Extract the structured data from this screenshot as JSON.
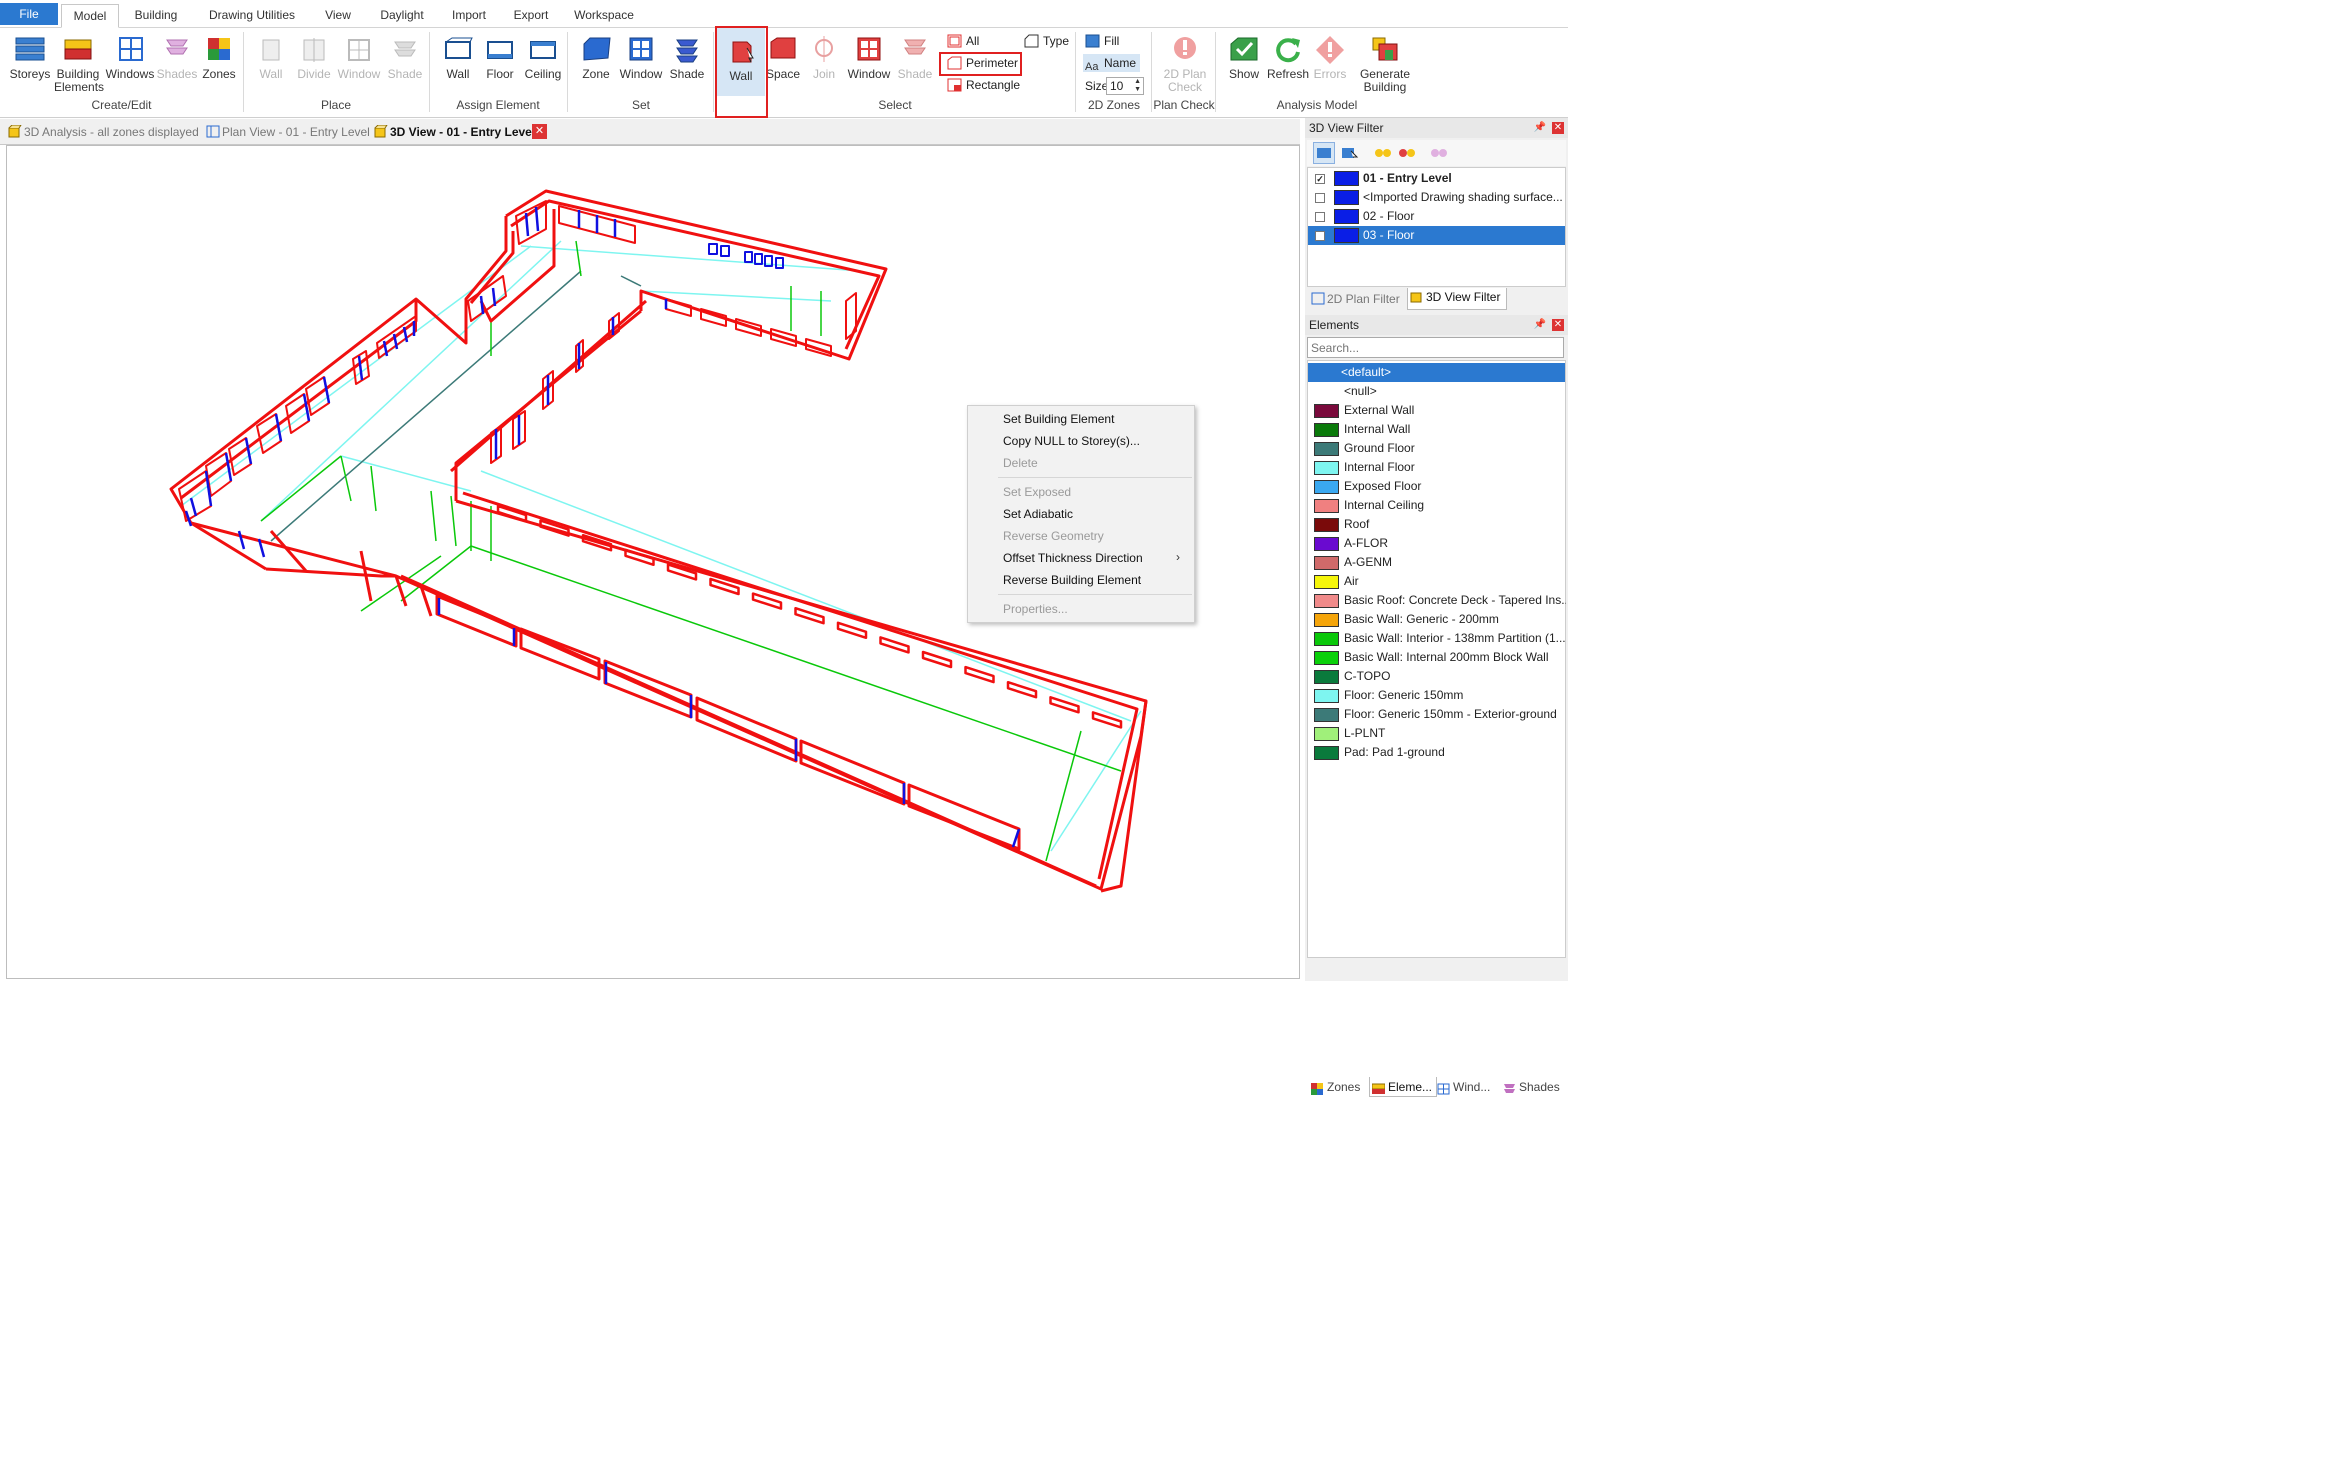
{
  "menu_tabs": [
    "File",
    "Model",
    "Building",
    "Drawing Utilities",
    "View",
    "Daylight",
    "Import",
    "Export",
    "Workspace"
  ],
  "ribbon": {
    "create_edit": {
      "label": "Create/Edit",
      "storeys": "Storeys",
      "building_elements_1": "Building",
      "building_elements_2": "Elements",
      "windows": "Windows",
      "shades": "Shades",
      "zones": "Zones"
    },
    "place": {
      "label": "Place",
      "wall": "Wall",
      "divide": "Divide",
      "window": "Window",
      "shade": "Shade"
    },
    "assign": {
      "label": "Assign Element",
      "wall": "Wall",
      "floor": "Floor",
      "ceiling": "Ceiling"
    },
    "set": {
      "label": "Set",
      "zone": "Zone",
      "window": "Window",
      "shade": "Shade"
    },
    "select": {
      "label": "Select",
      "wall": "Wall",
      "space": "Space",
      "join": "Join",
      "window": "Window",
      "shade": "Shade",
      "all": "All",
      "perimeter": "Perimeter",
      "rectangle": "Rectangle",
      "type": "Type"
    },
    "zones2d": {
      "label": "2D Zones",
      "fill": "Fill",
      "name": "Name",
      "size_label": "Size",
      "size_value": "10"
    },
    "plan_check": {
      "label": "Plan Check",
      "btn_1": "2D Plan",
      "btn_2": "Check"
    },
    "analysis": {
      "label": "Analysis Model",
      "show": "Show",
      "refresh": "Refresh",
      "errors": "Errors",
      "generate_1": "Generate",
      "generate_2": "Building"
    }
  },
  "doc_tabs": [
    "3D Analysis - all zones displayed",
    "Plan View - 01 - Entry Level",
    "3D View - 01 - Entry Level"
  ],
  "view_filter": {
    "title": "3D View Filter",
    "items": [
      {
        "label": "01 - Entry Level",
        "checked": true
      },
      {
        "label": "<Imported Drawing shading surface...",
        "checked": false
      },
      {
        "label": "02 - Floor",
        "checked": false
      },
      {
        "label": "03 - Floor",
        "checked": false
      }
    ],
    "tab_2d": "2D Plan Filter",
    "tab_3d": "3D View Filter"
  },
  "elements": {
    "title": "Elements",
    "search_placeholder": "Search...",
    "items": [
      {
        "label": "<default>",
        "color": ""
      },
      {
        "label": "<null>",
        "color": ""
      },
      {
        "label": "External Wall",
        "color": "#7a0a3c"
      },
      {
        "label": "Internal Wall",
        "color": "#0a7a0a"
      },
      {
        "label": "Ground Floor",
        "color": "#3c7a78"
      },
      {
        "label": "Internal Floor",
        "color": "#7ef5f0"
      },
      {
        "label": "Exposed Floor",
        "color": "#3aa8f0"
      },
      {
        "label": "Internal Ceiling",
        "color": "#f08080"
      },
      {
        "label": "Roof",
        "color": "#7a0a0a"
      },
      {
        "label": "A-FLOR",
        "color": "#6a0ad0"
      },
      {
        "label": "A-GENM",
        "color": "#d06a6a"
      },
      {
        "label": "Air",
        "color": "#f5f50a"
      },
      {
        "label": "Basic Roof: Concrete Deck - Tapered Ins...",
        "color": "#f08a8a"
      },
      {
        "label": "Basic Wall: Generic - 200mm",
        "color": "#f5a50a"
      },
      {
        "label": "Basic Wall: Interior - 138mm Partition (1...",
        "color": "#0ac80a"
      },
      {
        "label": "Basic Wall: Internal 200mm Block Wall",
        "color": "#0ad00a"
      },
      {
        "label": "C-TOPO",
        "color": "#0a7a3c"
      },
      {
        "label": "Floor: Generic 150mm",
        "color": "#7ef5f0"
      },
      {
        "label": "Floor: Generic 150mm - Exterior-ground",
        "color": "#3c7a78"
      },
      {
        "label": "L-PLNT",
        "color": "#a0f07a"
      },
      {
        "label": "Pad: Pad 1-ground",
        "color": "#0a7a3c"
      }
    ]
  },
  "context_menu": [
    {
      "label": "Set Building Element",
      "disabled": false
    },
    {
      "label": "Copy NULL to Storey(s)...",
      "disabled": false
    },
    {
      "label": "Delete",
      "disabled": true
    },
    {
      "label": "Set Exposed",
      "disabled": true
    },
    {
      "label": "Set Adiabatic",
      "disabled": false
    },
    {
      "label": "Reverse Geometry",
      "disabled": true
    },
    {
      "label": "Offset Thickness Direction",
      "disabled": false
    },
    {
      "label": "Reverse Building Element",
      "disabled": false
    },
    {
      "label": "Properties...",
      "disabled": true
    }
  ],
  "bottom_tabs": [
    "Zones",
    "Eleme...",
    "Wind...",
    "Shades"
  ]
}
